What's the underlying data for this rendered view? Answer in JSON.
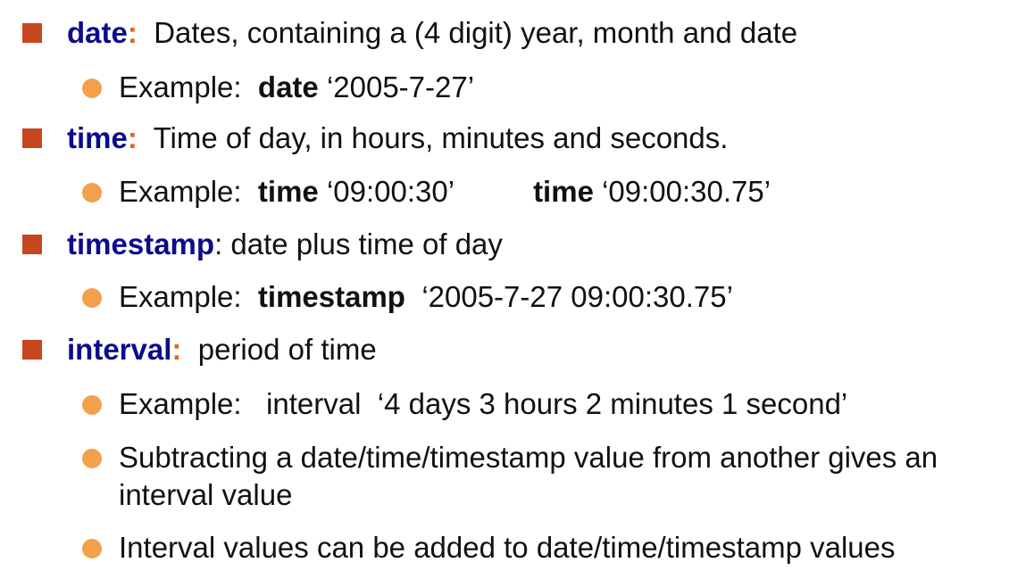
{
  "items": [
    {
      "term": "date",
      "colon": ":",
      "desc": "Dates, containing a (4 digit) year, month and date",
      "sub": [
        {
          "prefix": "Example:",
          "kw1": "date",
          "val1": "‘2005-7-27’"
        }
      ]
    },
    {
      "term": "time",
      "colon": ":",
      "desc": "Time of day, in hours, minutes and seconds.",
      "sub": [
        {
          "prefix": "Example:",
          "kw1": "time",
          "val1": "‘09:00:30’",
          "kw2": "time",
          "val2": "‘09:00:30.75’"
        }
      ]
    },
    {
      "term": "timestamp",
      "colon": ":",
      "desc": "date plus time of day",
      "sub": [
        {
          "prefix": "Example:",
          "kw1": "timestamp",
          "val1": "‘2005-7-27 09:00:30.75’"
        }
      ]
    },
    {
      "term": "interval",
      "colon": ":",
      "desc": "period of time",
      "sub": [
        {
          "prefix": "Example:",
          "text": "interval  ‘4 days 3 hours 2 minutes 1 second’"
        },
        {
          "text": "Subtracting a date/time/timestamp value from another gives an interval value"
        },
        {
          "text": "Interval values can be added to date/time/timestamp values"
        }
      ]
    }
  ],
  "colors": {
    "term": "#0b0b8c",
    "colon_accent": "#d96a1e",
    "square_bullet": "#c7461e",
    "round_bullet": "#f2a14a"
  },
  "icons": {
    "level1_bullet": "square-bullet-icon",
    "level2_bullet": "round-bullet-icon"
  }
}
